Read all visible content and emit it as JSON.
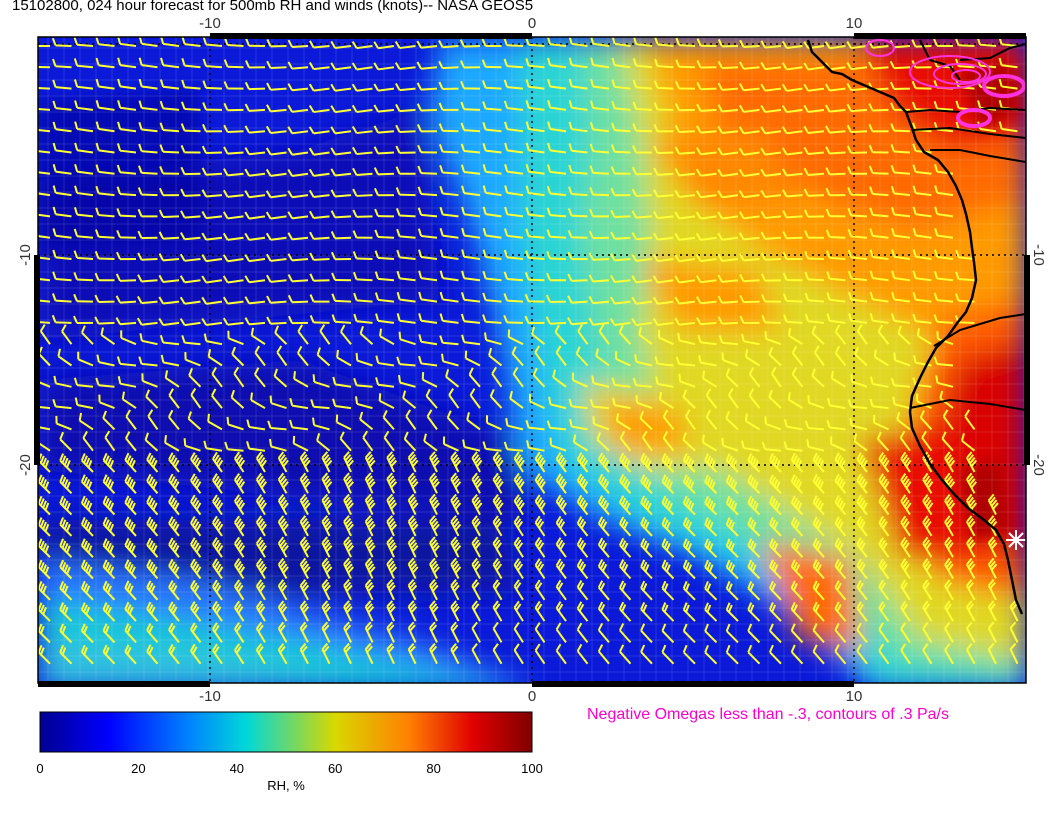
{
  "title": "15102800, 024 hour forecast for 500mb RH and winds (knots)-- NASA GEOS5",
  "map": {
    "x_ticks": [
      "-10",
      "0",
      "10"
    ],
    "y_ticks": [
      "-10",
      "-20"
    ],
    "field": "RH",
    "overlay": "wind barbs",
    "colors": {
      "barb": "#ffff33",
      "coast": "#000000",
      "omega_contour": "#ff33dd",
      "graticule": "#000000"
    }
  },
  "colorbar": {
    "ticks": [
      "0",
      "20",
      "40",
      "60",
      "80",
      "100"
    ],
    "label": "RH, %",
    "stops": [
      "#00008f",
      "#0000ff",
      "#0080ff",
      "#00d8d8",
      "#d8d800",
      "#ff8000",
      "#e00000",
      "#800000"
    ]
  },
  "omega_note": "Negative Omegas less than -.3, contours of .3 Pa/s"
}
